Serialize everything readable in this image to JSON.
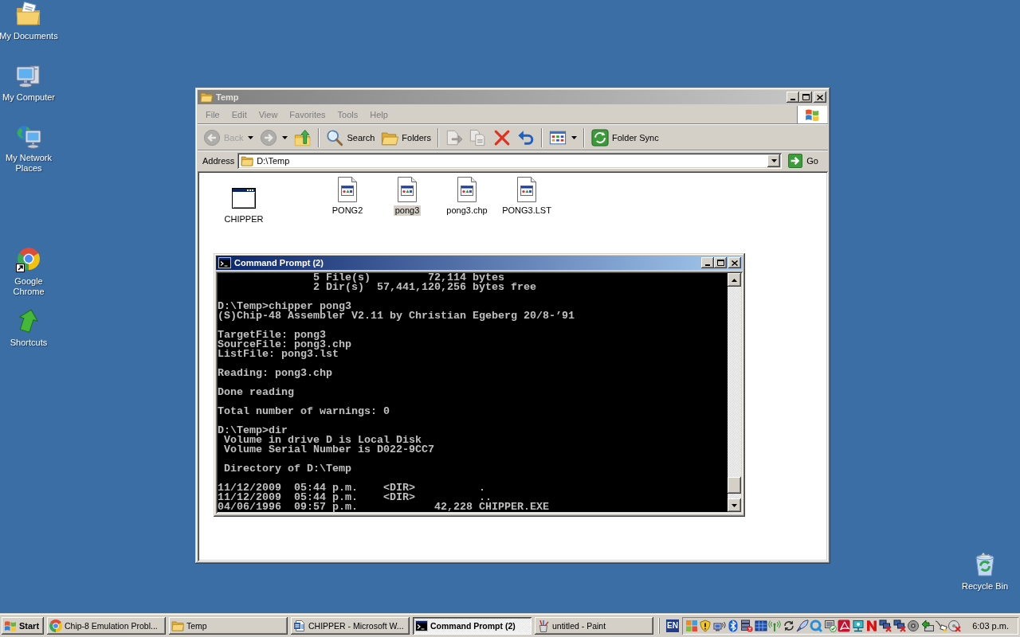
{
  "desktop_icons": [
    {
      "label": "My Documents",
      "kind": "documents"
    },
    {
      "label": "My Computer",
      "kind": "computer"
    },
    {
      "label": "My Network Places",
      "kind": "network"
    },
    {
      "label": "Google Chrome",
      "kind": "chrome"
    },
    {
      "label": "Shortcuts",
      "kind": "shortcuts"
    },
    {
      "label": "Recycle Bin",
      "kind": "recycle"
    }
  ],
  "explorer": {
    "title": "Temp",
    "active": false,
    "menu": [
      "File",
      "Edit",
      "View",
      "Favorites",
      "Tools",
      "Help"
    ],
    "toolbar": [
      [
        {
          "kind": "back",
          "label": "Back",
          "disabled": true
        },
        {
          "kind": "forward",
          "disabled": true
        },
        {
          "kind": "up",
          "disabled": false
        }
      ],
      [
        {
          "kind": "search",
          "label": "Search",
          "disabled": false
        },
        {
          "kind": "folders",
          "label": "Folders",
          "disabled": false
        }
      ],
      [
        {
          "kind": "move",
          "disabled": true
        },
        {
          "kind": "copy",
          "disabled": true
        },
        {
          "kind": "delete",
          "disabled": false
        },
        {
          "kind": "undo",
          "disabled": false
        }
      ],
      [
        {
          "kind": "views",
          "disabled": false
        }
      ],
      [
        {
          "kind": "sync",
          "label": "Folder Sync",
          "disabled": false
        }
      ]
    ],
    "address": {
      "label": "Address",
      "value": "D:\\Temp",
      "go": "Go"
    },
    "files": [
      {
        "name": "CHIPPER",
        "kind": "app",
        "selected": false
      },
      {
        "name": "PONG2",
        "kind": "file",
        "selected": false
      },
      {
        "name": "pong3",
        "kind": "file",
        "selected": true
      },
      {
        "name": "pong3.chp",
        "kind": "file",
        "selected": false
      },
      {
        "name": "PONG3.LST",
        "kind": "file",
        "selected": false
      }
    ]
  },
  "command_prompt": {
    "title": "Command Prompt (2)",
    "active": true,
    "blocks": [
      [
        "               5 File(s)         72,114 bytes",
        "               2 Dir(s)  57,441,120,256 bytes free"
      ],
      [
        "D:\\Temp>chipper pong3",
        "(S)Chip-48 Assembler V2.11 by Christian Egeberg 20/8-’91"
      ],
      [
        "TargetFile: pong3",
        "SourceFile: pong3.chp",
        "ListFile: pong3.lst"
      ],
      [
        "Reading: pong3.chp"
      ],
      [
        "Done reading"
      ],
      [
        "Total number of warnings: 0"
      ],
      [
        "D:\\Temp>dir",
        " Volume in drive D is Local Disk",
        " Volume Serial Number is D022-9CC7"
      ],
      [
        " Directory of D:\\Temp"
      ],
      [
        "11/12/2009  05:44 p.m.    <DIR>          .",
        "11/12/2009  05:44 p.m.    <DIR>          ..",
        "04/06/1996  09:57 p.m.            42,228 CHIPPER.EXE"
      ]
    ]
  },
  "taskbar": {
    "start": "Start",
    "tasks": [
      {
        "label": "Chip-8 Emulation Probl...",
        "kind": "chrome",
        "selected": false
      },
      {
        "label": "Temp",
        "kind": "folder",
        "selected": false
      },
      {
        "label": "CHIPPER - Microsoft W...",
        "kind": "word",
        "selected": false
      },
      {
        "label": "Command Prompt (2)",
        "kind": "console",
        "selected": true
      },
      {
        "label": "untitled - Paint",
        "kind": "paint",
        "selected": false
      }
    ],
    "language": "EN",
    "clock": "6:03 p.m."
  }
}
